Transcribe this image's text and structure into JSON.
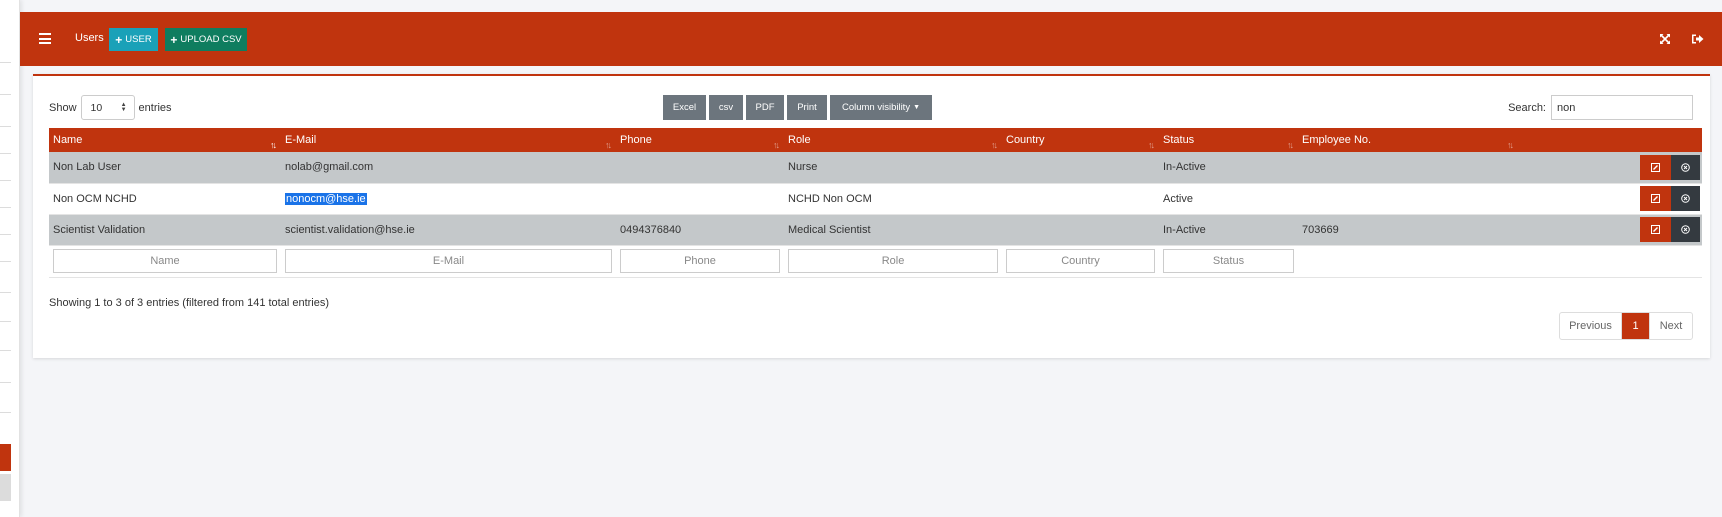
{
  "colors": {
    "primary": "#c0340e",
    "info": "#1aa1b8",
    "success": "#0f7d5f",
    "secondary": "#6c757d",
    "dark": "#343a40"
  },
  "header": {
    "title": "Users",
    "add_user_label": "USER",
    "upload_csv_label": "UPLOAD CSV",
    "icons": [
      "hamburger-icon",
      "expand-icon",
      "logout-icon"
    ]
  },
  "controls": {
    "show_label": "Show",
    "entries_value": "10",
    "entries_label": "entries",
    "search_label": "Search:",
    "search_value": "non"
  },
  "export_buttons": {
    "excel": "Excel",
    "csv": "csv",
    "pdf": "PDF",
    "print": "Print",
    "column_visibility": "Column visibility"
  },
  "table": {
    "columns": [
      "Name",
      "E-Mail",
      "Phone",
      "Role",
      "Country",
      "Status",
      "Employee No."
    ],
    "rows": [
      {
        "name": "Non Lab User",
        "email": "nolab@gmail.com",
        "phone": "",
        "role": "Nurse",
        "country": "",
        "status": "In-Active",
        "employee_no": ""
      },
      {
        "name": "Non OCM NCHD",
        "email": "nonocm@hse.ie",
        "phone": "",
        "role": "NCHD Non OCM",
        "country": "",
        "status": "Active",
        "employee_no": ""
      },
      {
        "name": "Scientist Validation",
        "email": "scientist.validation@hse.ie",
        "phone": "0494376840",
        "role": "Medical Scientist",
        "country": "",
        "status": "In-Active",
        "employee_no": "703669"
      }
    ],
    "filters": [
      "Name",
      "E-Mail",
      "Phone",
      "Role",
      "Country",
      "Status"
    ]
  },
  "footer": {
    "info": "Showing 1 to 3 of 3 entries (filtered from 141 total entries)",
    "previous": "Previous",
    "current_page": "1",
    "next": "Next"
  }
}
